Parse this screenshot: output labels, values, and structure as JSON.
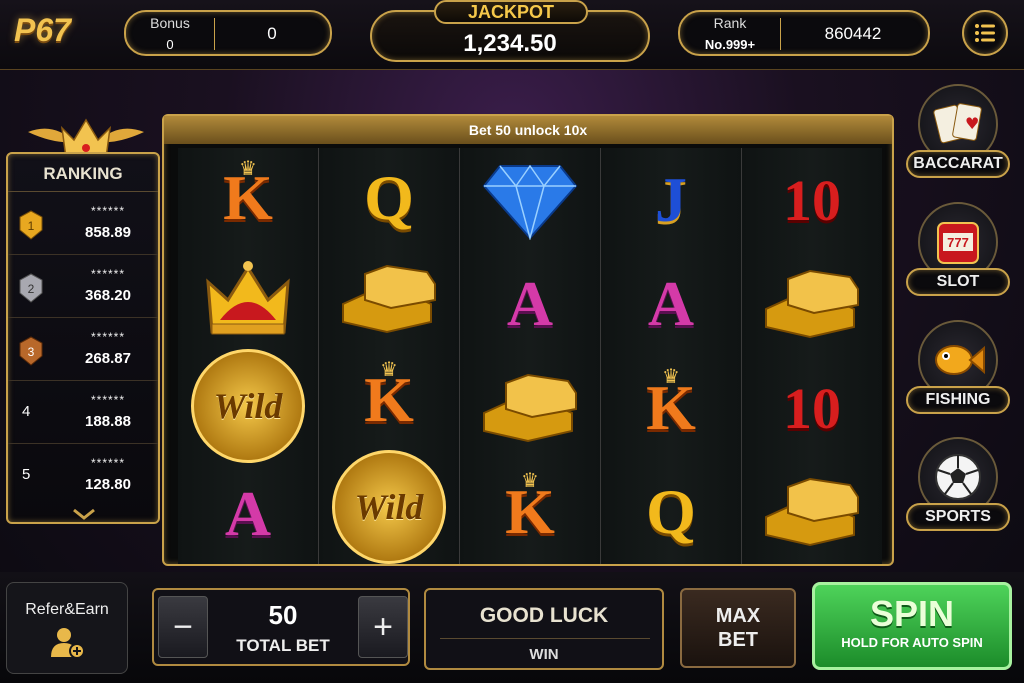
{
  "header": {
    "logo": "P67",
    "bonus": {
      "label": "Bonus",
      "value": "0",
      "secondary": "0"
    },
    "jackpot": {
      "label": "JACKPOT",
      "value": "1,234.50"
    },
    "rank": {
      "label": "Rank",
      "value": "No.999+",
      "secondary": "860442"
    }
  },
  "ranking": {
    "title": "RANKING",
    "rows": [
      {
        "rank": "1",
        "name": "******",
        "score": "858.89"
      },
      {
        "rank": "2",
        "name": "******",
        "score": "368.20"
      },
      {
        "rank": "3",
        "name": "******",
        "score": "268.87"
      },
      {
        "rank": "4",
        "name": "******",
        "score": "188.88"
      },
      {
        "rank": "5",
        "name": "******",
        "score": "128.80"
      }
    ]
  },
  "reels": {
    "banner": "Bet 50 unlock 10x",
    "columns": [
      [
        "K",
        "crown",
        "Wild",
        "A"
      ],
      [
        "Q",
        "gold-bars",
        "K",
        "Wild"
      ],
      [
        "diamond",
        "A",
        "gold-bars",
        "K"
      ],
      [
        "J",
        "A",
        "K",
        "Q"
      ],
      [
        "10",
        "gold-bars",
        "10",
        "gold-bars"
      ]
    ]
  },
  "games": [
    {
      "label": "BACCARAT",
      "icon": "cards-icon"
    },
    {
      "label": "SLOT",
      "icon": "slot-machine-icon"
    },
    {
      "label": "FISHING",
      "icon": "fish-icon"
    },
    {
      "label": "SPORTS",
      "icon": "soccer-ball-icon"
    }
  ],
  "footer": {
    "refer": "Refer&Earn",
    "bet_value": "50",
    "bet_label": "TOTAL BET",
    "minus": "−",
    "plus": "+",
    "message": "GOOD LUCK",
    "win_label": "WIN",
    "max_bet_line1": "MAX",
    "max_bet_line2": "BET",
    "spin": "SPIN",
    "spin_sub": "HOLD FOR AUTO SPIN"
  },
  "colors": {
    "gold": "#c9a24a",
    "spin_green": "#2fae3c"
  }
}
